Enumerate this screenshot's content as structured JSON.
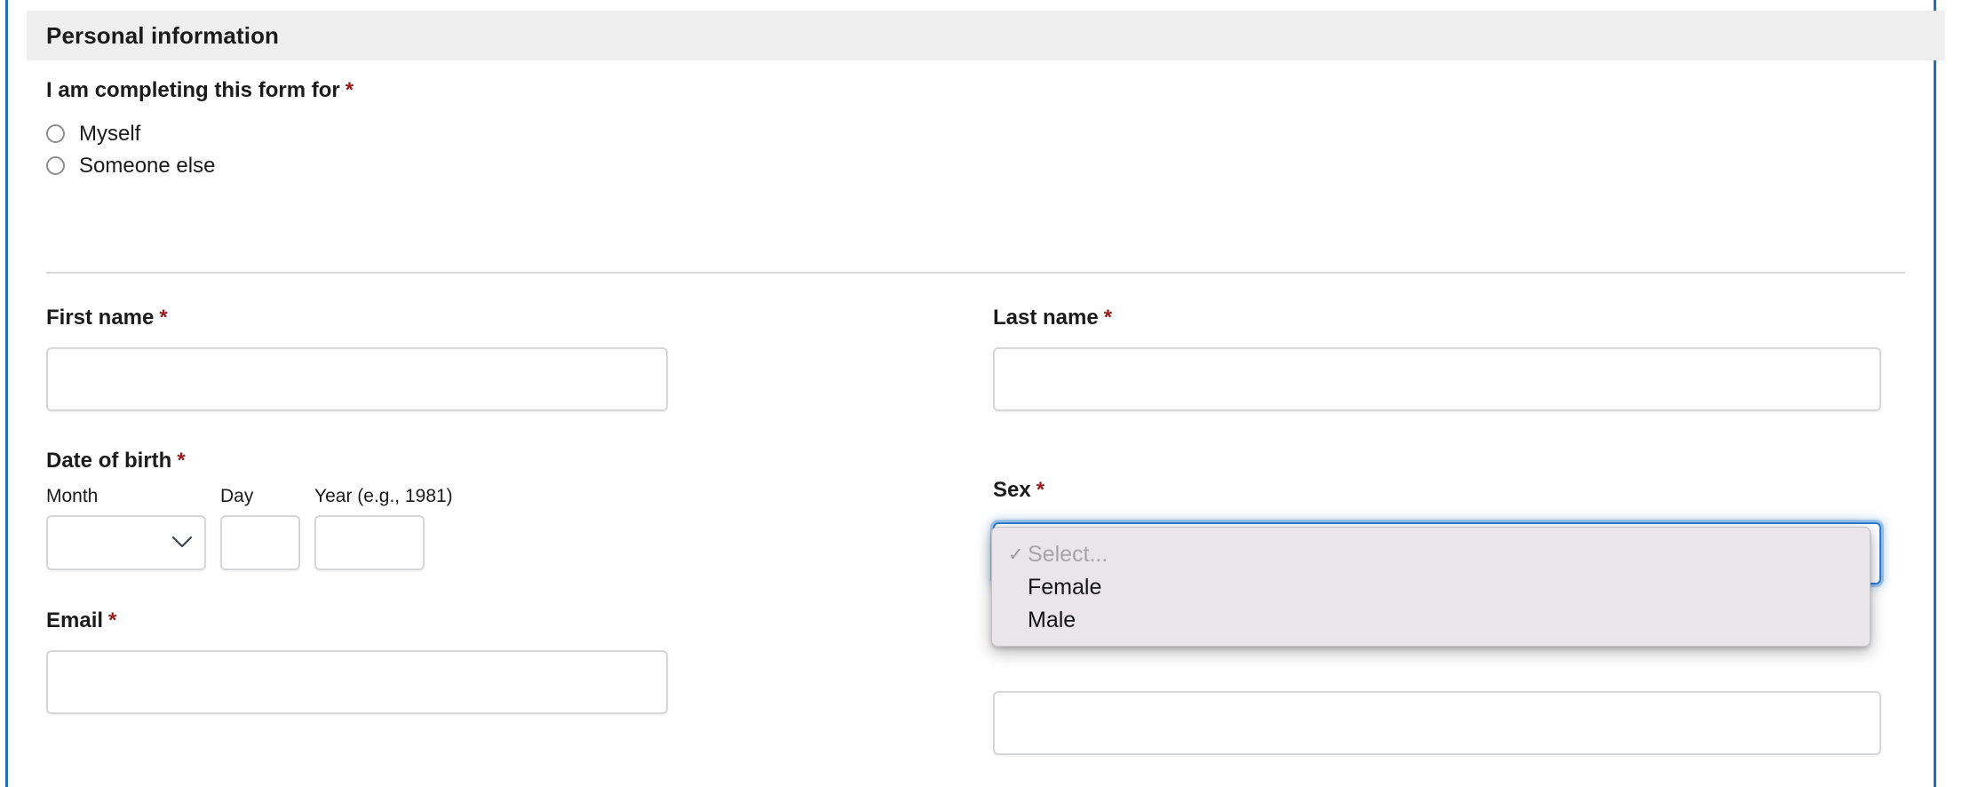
{
  "section": {
    "title": "Personal information"
  },
  "colors": {
    "rail": "#2171b5",
    "header_bg": "#efefef",
    "required_asterisk": "#981b1e",
    "focus_border": "#2d7dd2",
    "popup_bg": "#e9e5e8",
    "input_border": "#d6d7d9"
  },
  "required_marker": "*",
  "completing_for": {
    "label": "I am completing this form for",
    "required": true,
    "options": [
      {
        "label": "Myself",
        "selected": false
      },
      {
        "label": "Someone else",
        "selected": false
      }
    ]
  },
  "first_name": {
    "label": "First name",
    "required": true,
    "value": "",
    "placeholder": ""
  },
  "last_name": {
    "label": "Last name",
    "required": true,
    "value": "",
    "placeholder": ""
  },
  "date_of_birth": {
    "label": "Date of birth",
    "required": true,
    "month": {
      "label": "Month",
      "value": "",
      "type": "select"
    },
    "day": {
      "label": "Day",
      "value": "",
      "placeholder": "",
      "type": "text"
    },
    "year": {
      "label": "Year (e.g., 1981)",
      "value": "",
      "placeholder": "",
      "type": "text"
    }
  },
  "sex": {
    "label": "Sex",
    "required": true,
    "selected_value": "Select...",
    "expanded": true,
    "options": [
      {
        "label": "Select...",
        "selected": true,
        "placeholder": true,
        "checkmark": "✓"
      },
      {
        "label": "Female",
        "selected": false,
        "placeholder": false,
        "checkmark": ""
      },
      {
        "label": "Male",
        "selected": false,
        "placeholder": false,
        "checkmark": ""
      }
    ]
  },
  "email": {
    "label": "Email",
    "required": true,
    "value": "",
    "placeholder": ""
  },
  "right_lower_field": {
    "value": "",
    "placeholder": ""
  },
  "icons": {
    "chevron_down": "chevron-down-icon",
    "check": "check-icon"
  }
}
